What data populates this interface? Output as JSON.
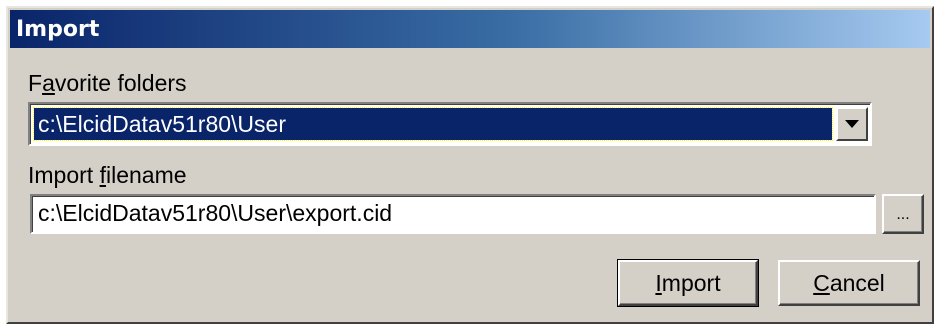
{
  "window": {
    "title": "Import"
  },
  "favorites": {
    "label_prefix": "F",
    "label_accel": "a",
    "label_suffix": "vorite folders",
    "selected_value": "c:\\ElcidDatav51r80\\User"
  },
  "import_file": {
    "label_prefix": "Import ",
    "label_accel": "f",
    "label_suffix": "ilename",
    "value": "c:\\ElcidDatav51r80\\User\\export.cid"
  },
  "buttons": {
    "browse_label": "...",
    "import_accel": "I",
    "import_suffix": "mport",
    "cancel_accel": "C",
    "cancel_suffix": "ancel"
  },
  "colors": {
    "title_start": "#0a246a",
    "title_end": "#a6caf0",
    "dialog_bg": "#d4d0c8",
    "selection_bg": "#0a246a"
  },
  "icons": {
    "combo_arrow": "chevron-down-icon"
  }
}
